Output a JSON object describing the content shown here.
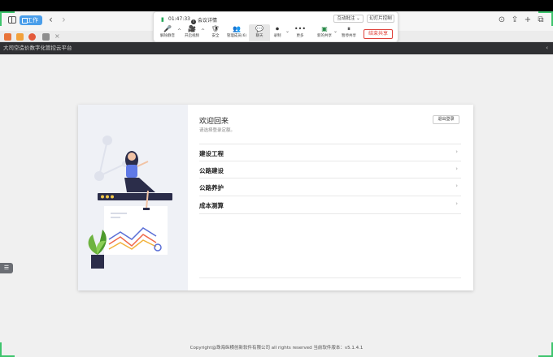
{
  "browser": {
    "tab_label": "工作",
    "back_glyph": "‹",
    "forward_glyph": "›",
    "close_glyph": "×",
    "right_icons": [
      "download-icon",
      "share-icon",
      "new-tab-icon",
      "tabs-overview-icon"
    ]
  },
  "meeting": {
    "time": "01:47:33",
    "info_label": "会议详情",
    "interactive_annot": "互动批注",
    "slides_control": "幻灯片控制",
    "tools": [
      {
        "icon": "🎤",
        "label": "解除静音"
      },
      {
        "icon": "🎥",
        "label": "开启视频"
      },
      {
        "icon": "🛡",
        "label": "安全"
      },
      {
        "icon": "👥",
        "label": "管理成员(6)"
      },
      {
        "icon": "💬",
        "label": "聊天"
      },
      {
        "icon": "⏺",
        "label": "录制"
      },
      {
        "icon": "•••",
        "label": "更多"
      },
      {
        "icon": "▣",
        "label": "新的共享"
      },
      {
        "icon": "⏸",
        "label": "暂停共享"
      }
    ],
    "end_share": "结束共享"
  },
  "app": {
    "title": "大司空造价数字化管控云平台"
  },
  "card": {
    "welcome": "欢迎回来",
    "subtitle": "请选择登录定额。",
    "logout": "退出登录",
    "items": [
      "建设工程",
      "公路建设",
      "公路养护",
      "成本测算"
    ]
  },
  "footer": "Copyright@珠海纵横创新软件有限公司 all rights reserved 当前软件版本：v5.1.4.1",
  "colors": {
    "accent": "#4a9eea",
    "danger": "#e0413a",
    "corner": "#3ec46d",
    "header": "#2f3033"
  }
}
